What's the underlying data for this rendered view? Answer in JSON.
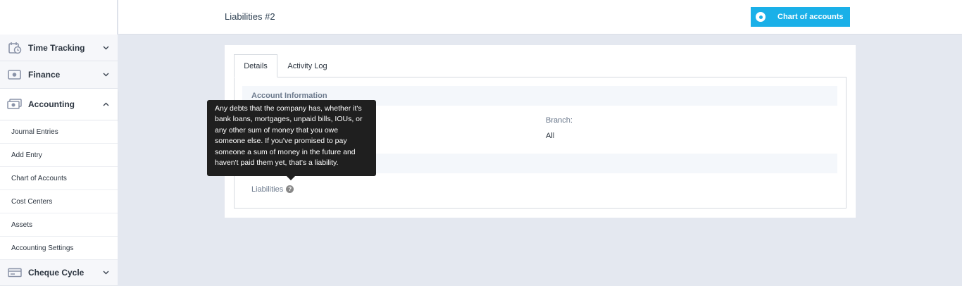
{
  "sidebar": {
    "sections": [
      {
        "label": "Time Tracking",
        "icon": "calendar-clock-icon",
        "expanded": false
      },
      {
        "label": "Finance",
        "icon": "cash-register-icon",
        "expanded": false
      },
      {
        "label": "Accounting",
        "icon": "banknote-icon",
        "expanded": true
      },
      {
        "label": "Cheque Cycle",
        "icon": "cheque-icon",
        "expanded": false
      }
    ],
    "accounting_items": [
      "Journal Entries",
      "Add Entry",
      "Chart of Accounts",
      "Cost Centers",
      "Assets",
      "Accounting Settings"
    ]
  },
  "header": {
    "title": "Liabilities #2",
    "chart_button_label": "Chart of accounts"
  },
  "tabs": [
    {
      "label": "Details",
      "active": true
    },
    {
      "label": "Activity Log",
      "active": false
    }
  ],
  "details": {
    "section_title": "Account Information",
    "branch_label": "Branch:",
    "branch_value": "All",
    "parent_label": "Liabilities"
  },
  "tooltip": {
    "text": "Any debts that the company has, whether it's bank loans, mortgages, unpaid bills, IOUs, or any other sum of money that you owe someone else. If you've promised to pay someone a sum of money in the future and haven't paid them yet, that's a liability."
  },
  "colors": {
    "accent": "#1ab0e8",
    "background": "#e4e8f0",
    "tooltip_bg": "#1f1f1f"
  }
}
